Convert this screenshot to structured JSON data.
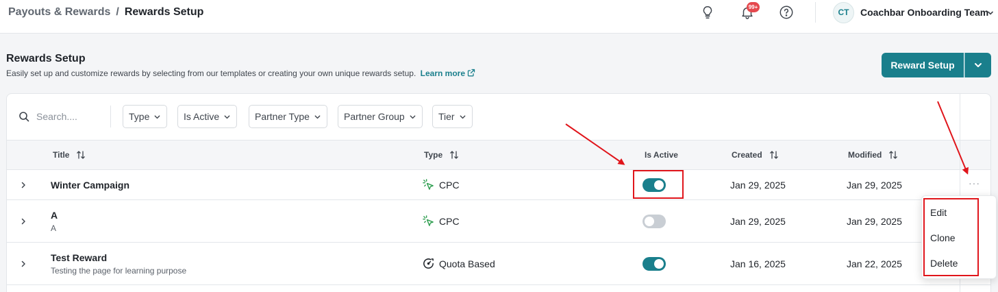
{
  "header": {
    "breadcrumb_parent": "Payouts & Rewards",
    "breadcrumb_sep": "/",
    "breadcrumb_current": "Rewards Setup",
    "notification_badge": "99+",
    "avatar_initials": "CT",
    "team_name": "Coachbar Onboarding Team"
  },
  "page": {
    "title": "Rewards Setup",
    "description": "Easily set up and customize rewards by selecting from our templates or creating your own unique rewards setup.",
    "learn_more": "Learn more",
    "primary_button": "Reward Setup"
  },
  "filters": {
    "search_placeholder": "Search....",
    "type": "Type",
    "is_active": "Is Active",
    "partner_type": "Partner Type",
    "partner_group": "Partner Group",
    "tier": "Tier"
  },
  "table": {
    "columns": {
      "title": "Title",
      "type": "Type",
      "is_active": "Is Active",
      "created": "Created",
      "modified": "Modified"
    },
    "rows": [
      {
        "title": "Winter Campaign",
        "subtitle": "",
        "type": "CPC",
        "active": true,
        "created": "Jan 29, 2025",
        "modified": "Jan 29, 2025"
      },
      {
        "title": "A",
        "subtitle": "A",
        "type": "CPC",
        "active": false,
        "created": "Jan 29, 2025",
        "modified": "Jan 29, 2025"
      },
      {
        "title": "Test Reward",
        "subtitle": "Testing the page for learning purpose",
        "type": "Quota Based",
        "active": true,
        "created": "Jan 16, 2025",
        "modified": "Jan 22, 2025"
      }
    ]
  },
  "row_menu": {
    "trigger": "···",
    "items": [
      "Edit",
      "Clone",
      "Delete"
    ]
  },
  "colors": {
    "accent": "#1a7f8c",
    "annotation": "#e0151b",
    "badge": "#e5484d"
  }
}
